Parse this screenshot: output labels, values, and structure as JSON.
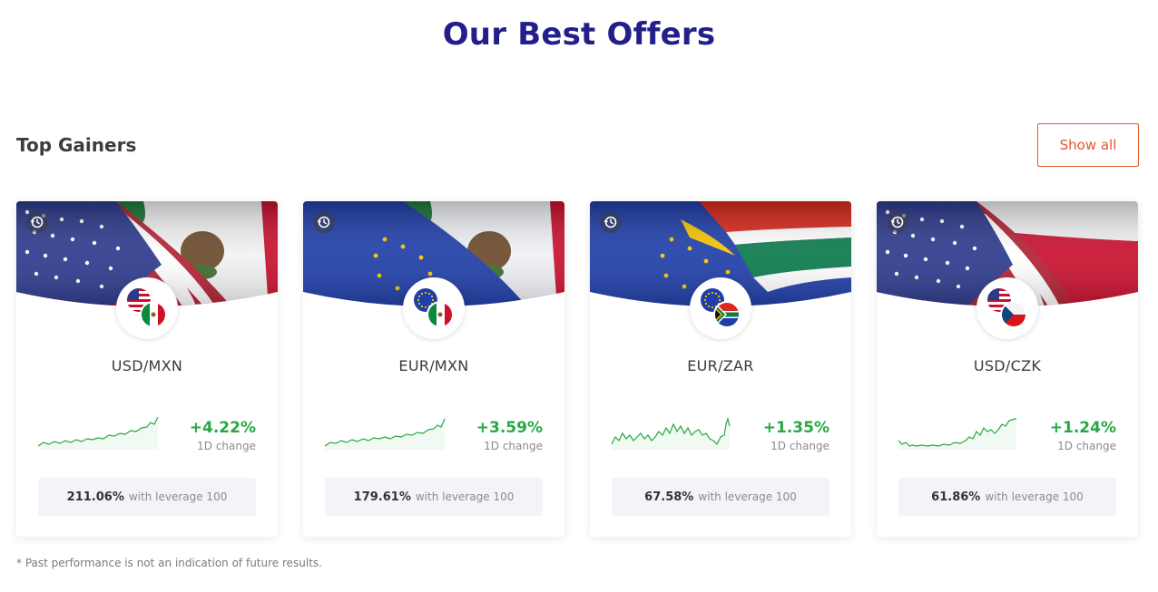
{
  "page": {
    "title": "Our Best Offers",
    "section_title": "Top Gainers",
    "show_all_label": "Show all",
    "disclaimer": "* Past performance is not an indication of future results."
  },
  "colors": {
    "title": "#231f8a",
    "accent": "#e0592a",
    "positive": "#27a844"
  },
  "cards": [
    {
      "pair": "USD/MXN",
      "change": "+4.22%",
      "change_label": "1D change",
      "leverage_value": "211.06%",
      "leverage_label": "with leverage 100",
      "base_flag": "us-flag",
      "quote_flag": "mx-flag",
      "icon": "history-icon"
    },
    {
      "pair": "EUR/MXN",
      "change": "+3.59%",
      "change_label": "1D change",
      "leverage_value": "179.61%",
      "leverage_label": "with leverage 100",
      "base_flag": "eu-flag",
      "quote_flag": "mx-flag",
      "icon": "history-icon"
    },
    {
      "pair": "EUR/ZAR",
      "change": "+1.35%",
      "change_label": "1D change",
      "leverage_value": "67.58%",
      "leverage_label": "with leverage 100",
      "base_flag": "eu-flag",
      "quote_flag": "za-flag",
      "icon": "history-icon"
    },
    {
      "pair": "USD/CZK",
      "change": "+1.24%",
      "change_label": "1D change",
      "leverage_value": "61.86%",
      "leverage_label": "with leverage 100",
      "base_flag": "us-flag",
      "quote_flag": "cz-flag",
      "icon": "history-icon"
    }
  ]
}
